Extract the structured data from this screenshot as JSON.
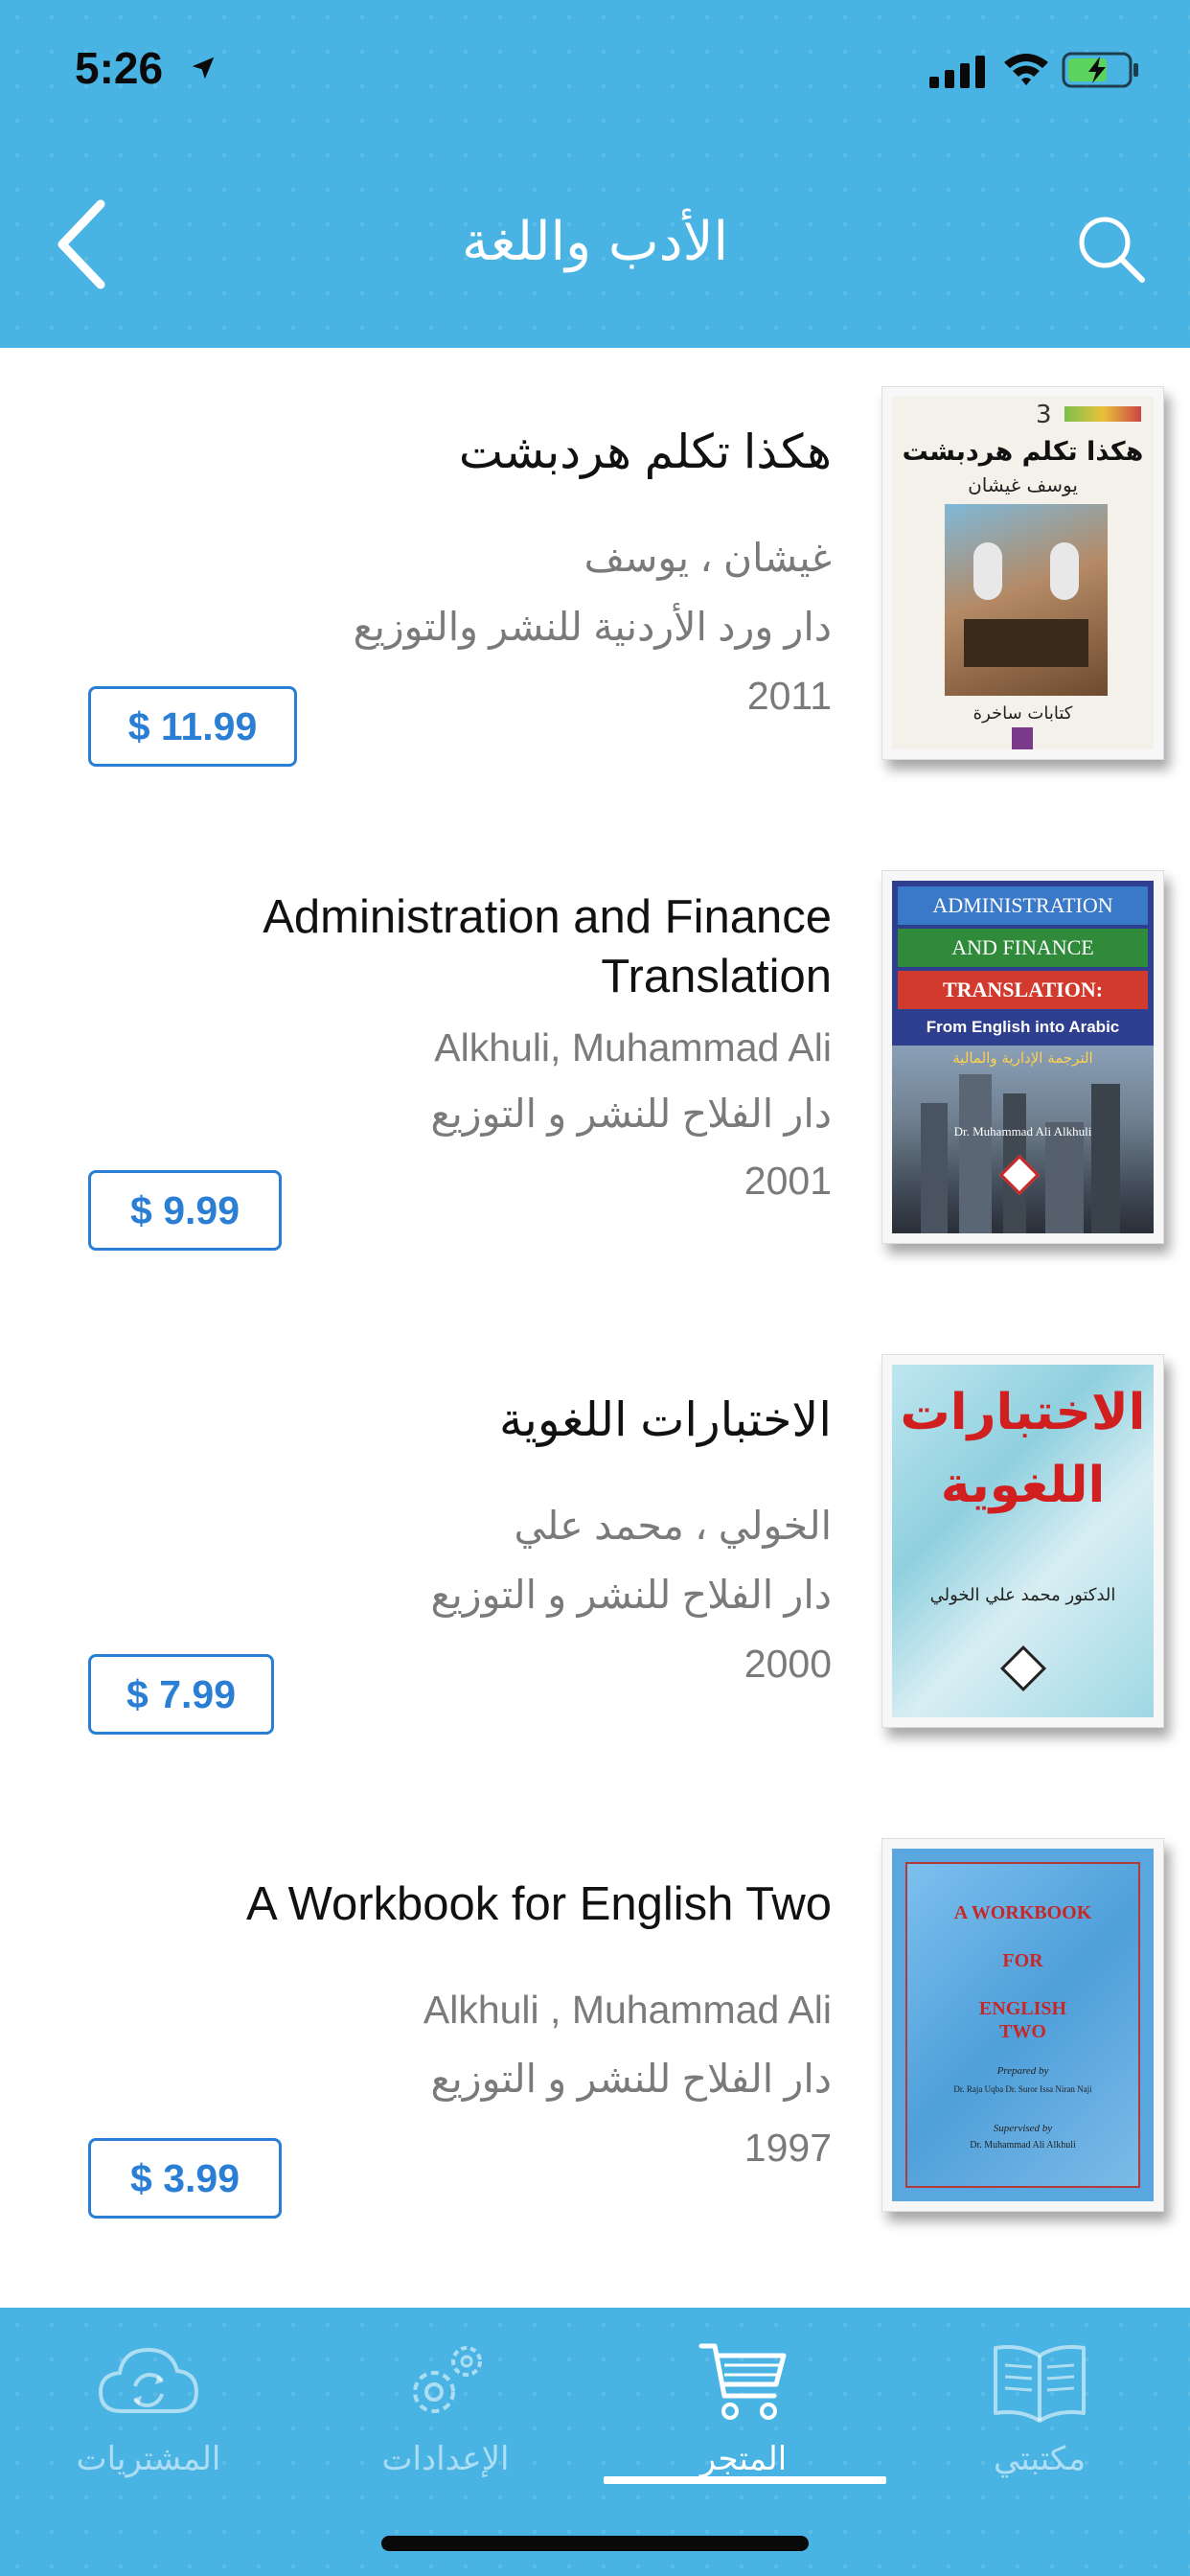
{
  "status_bar": {
    "time": "5:26"
  },
  "nav": {
    "title": "الأدب واللغة"
  },
  "books": [
    {
      "title": "هكذا تكلم هردبشت",
      "author": "غيشان ، يوسف",
      "publisher": "دار ورد الأردنية للنشر والتوزيع",
      "year": "2011",
      "price": "$ 11.99",
      "cover": {
        "lines": [
          "هكذا تكلم هردبشت",
          "يوسف غيشان",
          "كتابات ساخرة"
        ],
        "number": "3"
      }
    },
    {
      "title": "Administration and Finance Translation",
      "author": "Alkhuli, Muhammad Ali",
      "publisher": "دار الفلاح للنشر و التوزيع",
      "year": "2001",
      "price": "$ 9.99",
      "cover": {
        "lines": [
          "ADMINISTRATION",
          "AND FINANCE",
          "TRANSLATION:",
          "From English into Arabic",
          "الترجمة الإدارية والمالية",
          "Dr. Muhammad Ali Alkhuli"
        ]
      }
    },
    {
      "title": "الاختبارات اللغوية",
      "author": "الخولي ، محمد علي",
      "publisher": "دار الفلاح للنشر و التوزيع",
      "year": "2000",
      "price": "$ 7.99",
      "cover": {
        "lines": [
          "الاختبارات",
          "اللغوية",
          "الدكتور محمد علي الخولي"
        ]
      }
    },
    {
      "title": "A Workbook for English Two",
      "author": "Alkhuli , Muhammad Ali",
      "publisher": "دار الفلاح للنشر و التوزيع",
      "year": "1997",
      "price": "$ 3.99",
      "cover": {
        "lines": [
          "A WORKBOOK",
          "FOR",
          "ENGLISH",
          "TWO",
          "Prepared by",
          "Dr. Raja Uqba   Dr. Suror Issa   Niran Naji",
          "Supervised by",
          "Dr. Muhammad Ali Alkhuli"
        ]
      }
    }
  ],
  "tabs": [
    {
      "label": "المشتريات",
      "icon": "cloud-sync-icon"
    },
    {
      "label": "الإعدادات",
      "icon": "gears-icon"
    },
    {
      "label": "المتجر",
      "icon": "cart-icon"
    },
    {
      "label": "مكتبتي",
      "icon": "open-book-icon"
    }
  ],
  "colors": {
    "header": "#49b4e3",
    "price": "#2a7fd4"
  }
}
